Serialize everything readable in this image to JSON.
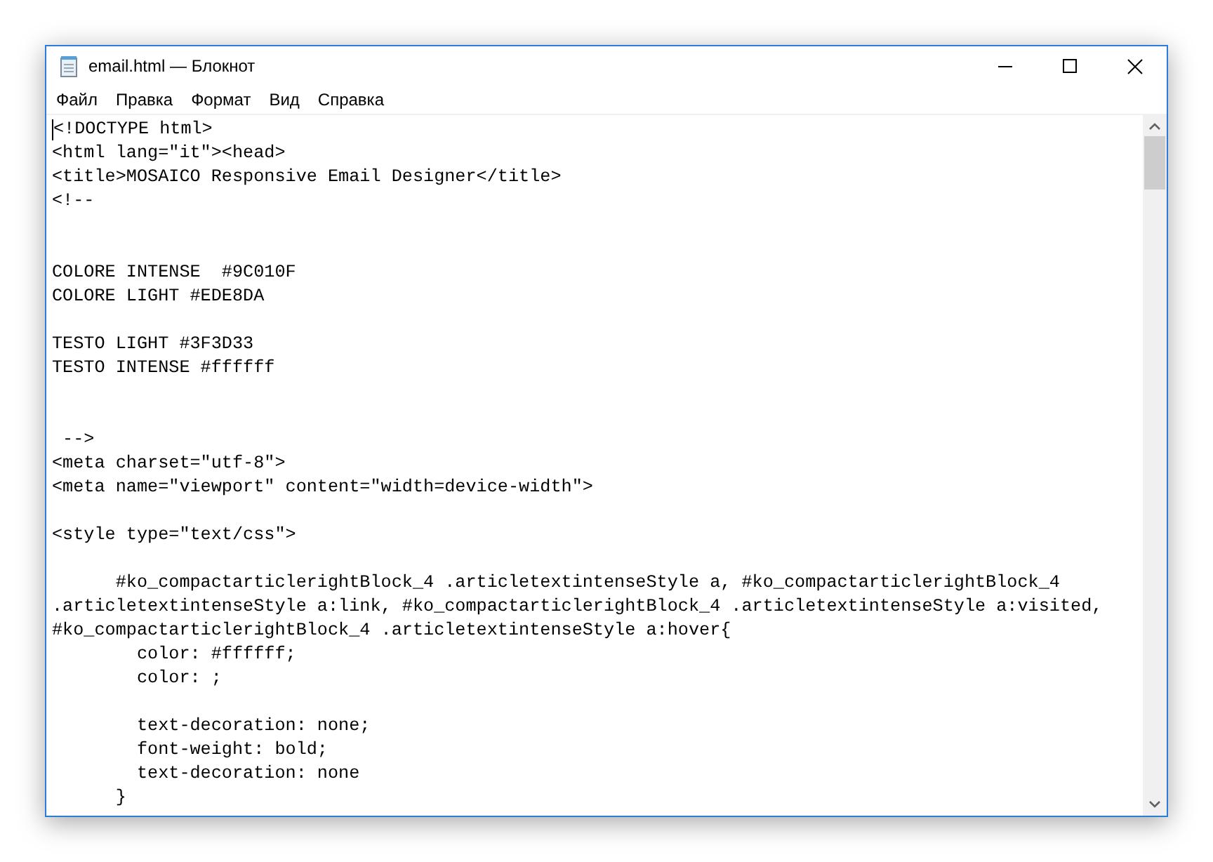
{
  "window": {
    "title": "email.html — Блокнот"
  },
  "menu": [
    "Файл",
    "Правка",
    "Формат",
    "Вид",
    "Справка"
  ],
  "editor": {
    "lines": [
      {
        "kind": "text",
        "text": "<!DOCTYPE html>"
      },
      {
        "kind": "text",
        "text": "<html lang=\"it\"><head>"
      },
      {
        "kind": "text",
        "text": "<title>MOSAICO Responsive Email Designer</title>"
      },
      {
        "kind": "text",
        "text": "<!--"
      },
      {
        "kind": "blank"
      },
      {
        "kind": "blank"
      },
      {
        "kind": "text",
        "text": "COLORE INTENSE  #9C010F"
      },
      {
        "kind": "text",
        "text": "COLORE LIGHT #EDE8DA"
      },
      {
        "kind": "blank"
      },
      {
        "kind": "text",
        "text": "TESTO LIGHT #3F3D33"
      },
      {
        "kind": "text",
        "text": "TESTO INTENSE #ffffff"
      },
      {
        "kind": "blank"
      },
      {
        "kind": "blank"
      },
      {
        "kind": "text",
        "text": " -->"
      },
      {
        "kind": "text",
        "text": "<meta charset=\"utf-8\">"
      },
      {
        "kind": "text",
        "text": "<meta name=\"viewport\" content=\"width=device-width\">"
      },
      {
        "kind": "blank"
      },
      {
        "kind": "text",
        "text": "<style type=\"text/css\">"
      },
      {
        "kind": "blank"
      },
      {
        "kind": "text",
        "text": "      #ko_compactarticlerightBlock_4 .articletextintenseStyle a, #ko_compactarticlerightBlock_4"
      },
      {
        "kind": "text",
        "text": ".articletextintenseStyle a:link, #ko_compactarticlerightBlock_4 .articletextintenseStyle a:visited,"
      },
      {
        "kind": "text",
        "text": "#ko_compactarticlerightBlock_4 .articletextintenseStyle a:hover{"
      },
      {
        "kind": "text",
        "text": "        color: #ffffff;"
      },
      {
        "kind": "text",
        "text": "        color: ;"
      },
      {
        "kind": "blank"
      },
      {
        "kind": "text",
        "text": "        text-decoration: none;"
      },
      {
        "kind": "text",
        "text": "        font-weight: bold;"
      },
      {
        "kind": "text",
        "text": "        text-decoration: none"
      },
      {
        "kind": "text",
        "text": "      }"
      }
    ]
  }
}
